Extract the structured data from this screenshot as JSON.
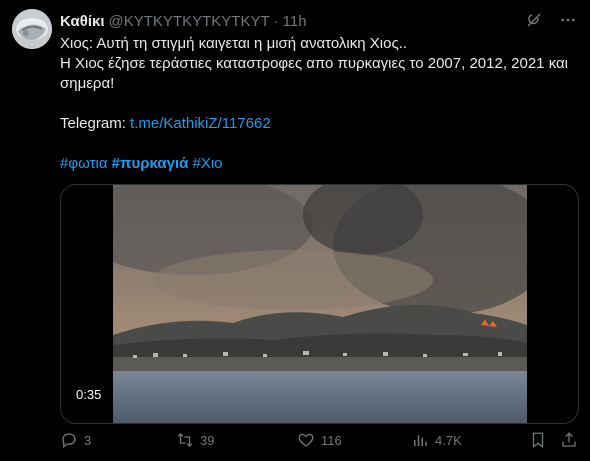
{
  "tweet": {
    "display_name": "Καθίκι",
    "handle": "@KYTKYTKYTKYTKYT",
    "separator": "·",
    "time": "11h",
    "lines": [
      "Χιος: Αυτή τη στιγμή καιγεται η μισή ανατολικη Χιος..",
      "Η Χιος έζησε τεράστιες καταστροφες απο πυρκαγιες το 2007, 2012, 2021 και",
      "σημερα!"
    ],
    "telegram_label": "Telegram:",
    "telegram_link": "t.me/KathikiZ/117662",
    "hashtags": [
      "#φωτια",
      "#πυρκαγιά",
      "#Χιο"
    ]
  },
  "media": {
    "duration": "0:35"
  },
  "actions": {
    "replies": "3",
    "reposts": "39",
    "likes": "116",
    "views": "4.7K"
  },
  "colors": {
    "background": "#000000",
    "text": "#e7e9ea",
    "muted": "#71767b",
    "accent": "#1d9bf0",
    "border": "#2f3336"
  },
  "icons": {
    "grok": "grok-icon",
    "more": "more-icon",
    "reply": "reply-icon",
    "repost": "repost-icon",
    "like": "like-icon",
    "views": "views-icon",
    "bookmark": "bookmark-icon",
    "share": "share-icon"
  }
}
